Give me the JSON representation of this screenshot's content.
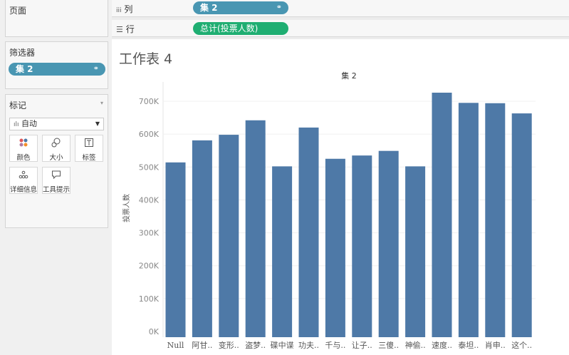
{
  "left_panel": {
    "pages_title": "页面",
    "filters_title": "筛选器",
    "filter_pill": {
      "label": "集 2",
      "icon": "link-icon"
    },
    "marks_title": "标记",
    "mark_type": {
      "icon": "bar-chart-icon",
      "label": "自动"
    },
    "mark_buttons": [
      {
        "label": "颜色",
        "icon": "color-dots-icon"
      },
      {
        "label": "大小",
        "icon": "size-icon"
      },
      {
        "label": "标签",
        "icon": "label-icon"
      },
      {
        "label": "详细信息",
        "icon": "detail-icon"
      },
      {
        "label": "工具提示",
        "icon": "tooltip-icon"
      }
    ]
  },
  "shelves": {
    "columns": {
      "label": "列",
      "pill": "集 2"
    },
    "rows": {
      "label": "行",
      "pill": "总计(投票人数)"
    }
  },
  "sheet": {
    "title": "工作表 4"
  },
  "colors": {
    "bar": "#4e79a7",
    "blue_pill": "#4996b2",
    "green_pill": "#1fae72"
  },
  "chart_data": {
    "type": "bar",
    "title": "集 2",
    "xlabel": "",
    "ylabel": "投票人数",
    "categories": [
      "Null",
      "阿甘..",
      "变形..",
      "盗梦..",
      "碟中谍",
      "功夫..",
      "千与..",
      "让子..",
      "三傻..",
      "神偷..",
      "速度..",
      "泰坦..",
      "肖申..",
      "这个.."
    ],
    "values": [
      514000,
      581000,
      598000,
      642000,
      502000,
      620000,
      525000,
      535000,
      549000,
      502000,
      726000,
      695000,
      694000,
      663000
    ],
    "ylim": [
      0,
      750000
    ],
    "yticks": [
      0,
      100000,
      200000,
      300000,
      400000,
      500000,
      600000,
      700000
    ],
    "ytick_labels": [
      "0K",
      "100K",
      "200K",
      "300K",
      "400K",
      "500K",
      "600K",
      "700K"
    ],
    "grid": true
  }
}
